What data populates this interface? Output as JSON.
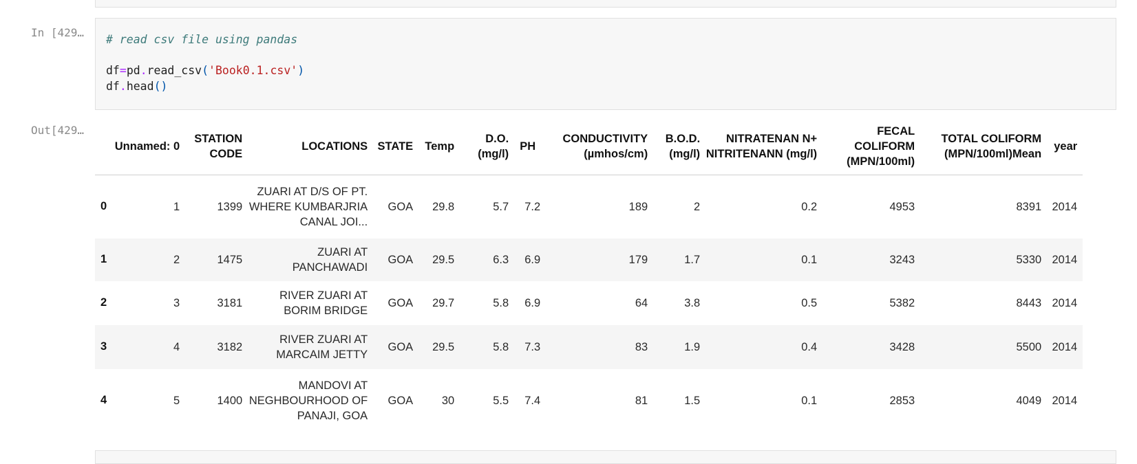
{
  "input_cell": {
    "prompt": "In [429…",
    "code": {
      "comment": "# read csv file using pandas",
      "line2": {
        "var": "df",
        "eq": "=",
        "mod": "pd",
        "dot": ".",
        "func": "read_csv",
        "open": "(",
        "arg": "'Book0.1.csv'",
        "close": ")"
      },
      "line3": {
        "var": "df",
        "dot": ".",
        "func": "head",
        "parens": "()"
      }
    }
  },
  "output_cell": {
    "prompt": "Out[429…",
    "table": {
      "columns": [
        "Unnamed: 0",
        "STATION CODE",
        "LOCATIONS",
        "STATE",
        "Temp",
        "D.O. (mg/l)",
        "PH",
        "CONDUCTIVITY (µmhos/cm)",
        "B.O.D. (mg/l)",
        "NITRATENAN N+ NITRITENANN (mg/l)",
        "FECAL COLIFORM (MPN/100ml)",
        "TOTAL COLIFORM (MPN/100ml)Mean",
        "year"
      ],
      "rows": [
        {
          "index": "0",
          "cells": [
            "1",
            "1399",
            "ZUARI AT D/S OF PT. WHERE KUMBARJRIA CANAL JOI...",
            "GOA",
            "29.8",
            "5.7",
            "7.2",
            "189",
            "2",
            "0.2",
            "4953",
            "8391",
            "2014"
          ]
        },
        {
          "index": "1",
          "cells": [
            "2",
            "1475",
            "ZUARI AT PANCHAWADI",
            "GOA",
            "29.5",
            "6.3",
            "6.9",
            "179",
            "1.7",
            "0.1",
            "3243",
            "5330",
            "2014"
          ]
        },
        {
          "index": "2",
          "cells": [
            "3",
            "3181",
            "RIVER ZUARI AT BORIM BRIDGE",
            "GOA",
            "29.7",
            "5.8",
            "6.9",
            "64",
            "3.8",
            "0.5",
            "5382",
            "8443",
            "2014"
          ]
        },
        {
          "index": "3",
          "cells": [
            "4",
            "3182",
            "RIVER ZUARI AT MARCAIM JETTY",
            "GOA",
            "29.5",
            "5.8",
            "7.3",
            "83",
            "1.9",
            "0.4",
            "3428",
            "5500",
            "2014"
          ]
        },
        {
          "index": "4",
          "cells": [
            "5",
            "1400",
            "MANDOVI AT NEGHBOURHOOD OF PANAJI, GOA",
            "GOA",
            "30",
            "5.5",
            "7.4",
            "81",
            "1.5",
            "0.1",
            "2853",
            "4049",
            "2014"
          ]
        }
      ]
    }
  }
}
